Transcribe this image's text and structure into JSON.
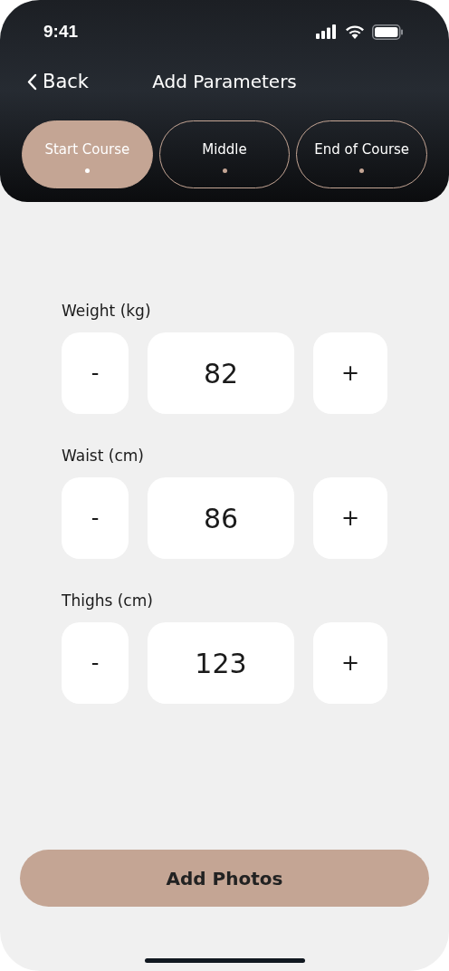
{
  "status_bar": {
    "time": "9:41"
  },
  "nav": {
    "back": "Back",
    "title": "Add Parameters"
  },
  "tabs": [
    {
      "label": "Start Course",
      "selected": true
    },
    {
      "label": "Middle",
      "selected": false
    },
    {
      "label": "End of Course",
      "selected": false
    }
  ],
  "parameters": [
    {
      "label": "Weight (kg)",
      "decrement": "-",
      "value": "82",
      "increment": "+"
    },
    {
      "label": "Waist (cm)",
      "decrement": "-",
      "value": "86",
      "increment": "+"
    },
    {
      "label": "Thighs (cm)",
      "decrement": "-",
      "value": "123",
      "increment": "+"
    }
  ],
  "primary_button": "Add Photos"
}
